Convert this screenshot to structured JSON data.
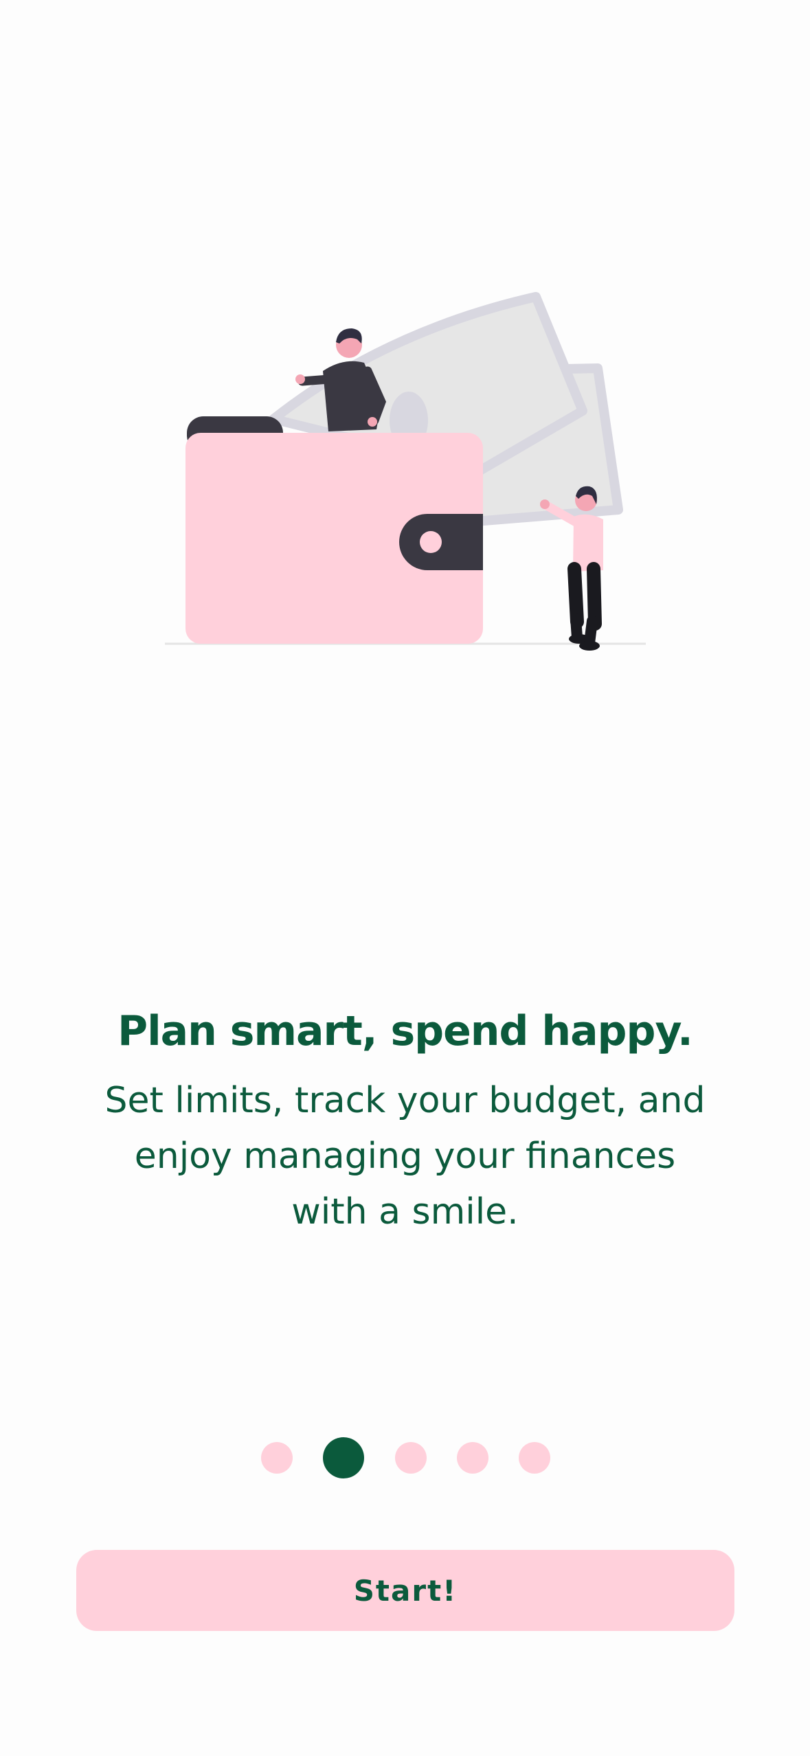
{
  "onboarding": {
    "headline": "Plan smart, spend happy.",
    "body": "Set limits, track your budget, and enjoy managing your finances with a smile."
  },
  "pager": {
    "total": 5,
    "active_index": 1
  },
  "start_button": {
    "label": "Start!"
  },
  "colors": {
    "primary_green": "#0b5a3c",
    "pink": "#ffd0db",
    "wallet_dark": "#3a3842",
    "banknote_light": "#e6e6e6",
    "banknote_border": "#d8d7e0"
  },
  "illustration": {
    "subject": "wallet-with-money-illustration"
  }
}
